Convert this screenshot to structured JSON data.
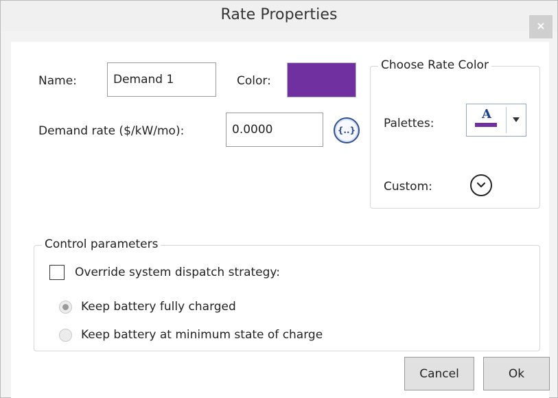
{
  "dialog": {
    "title": "Rate Properties",
    "close_label": "×"
  },
  "form": {
    "name_label": "Name:",
    "name_value": "Demand 1",
    "color_label": "Color:",
    "color_value": "#7030a0",
    "demand_rate_label": "Demand rate ($/kW/mo):",
    "demand_rate_value": "0.0000",
    "expression_button_label": "{..}"
  },
  "choose_color": {
    "title": "Choose Rate Color",
    "palettes_label": "Palettes:",
    "palette_letter": "A",
    "custom_label": "Custom:"
  },
  "control": {
    "title": "Control parameters",
    "override_label": "Override system dispatch strategy:",
    "override_checked": false,
    "radio_options": [
      {
        "label": "Keep battery fully charged",
        "selected": true
      },
      {
        "label": "Keep battery at minimum state of charge",
        "selected": false
      }
    ]
  },
  "buttons": {
    "cancel": "Cancel",
    "ok": "Ok"
  }
}
